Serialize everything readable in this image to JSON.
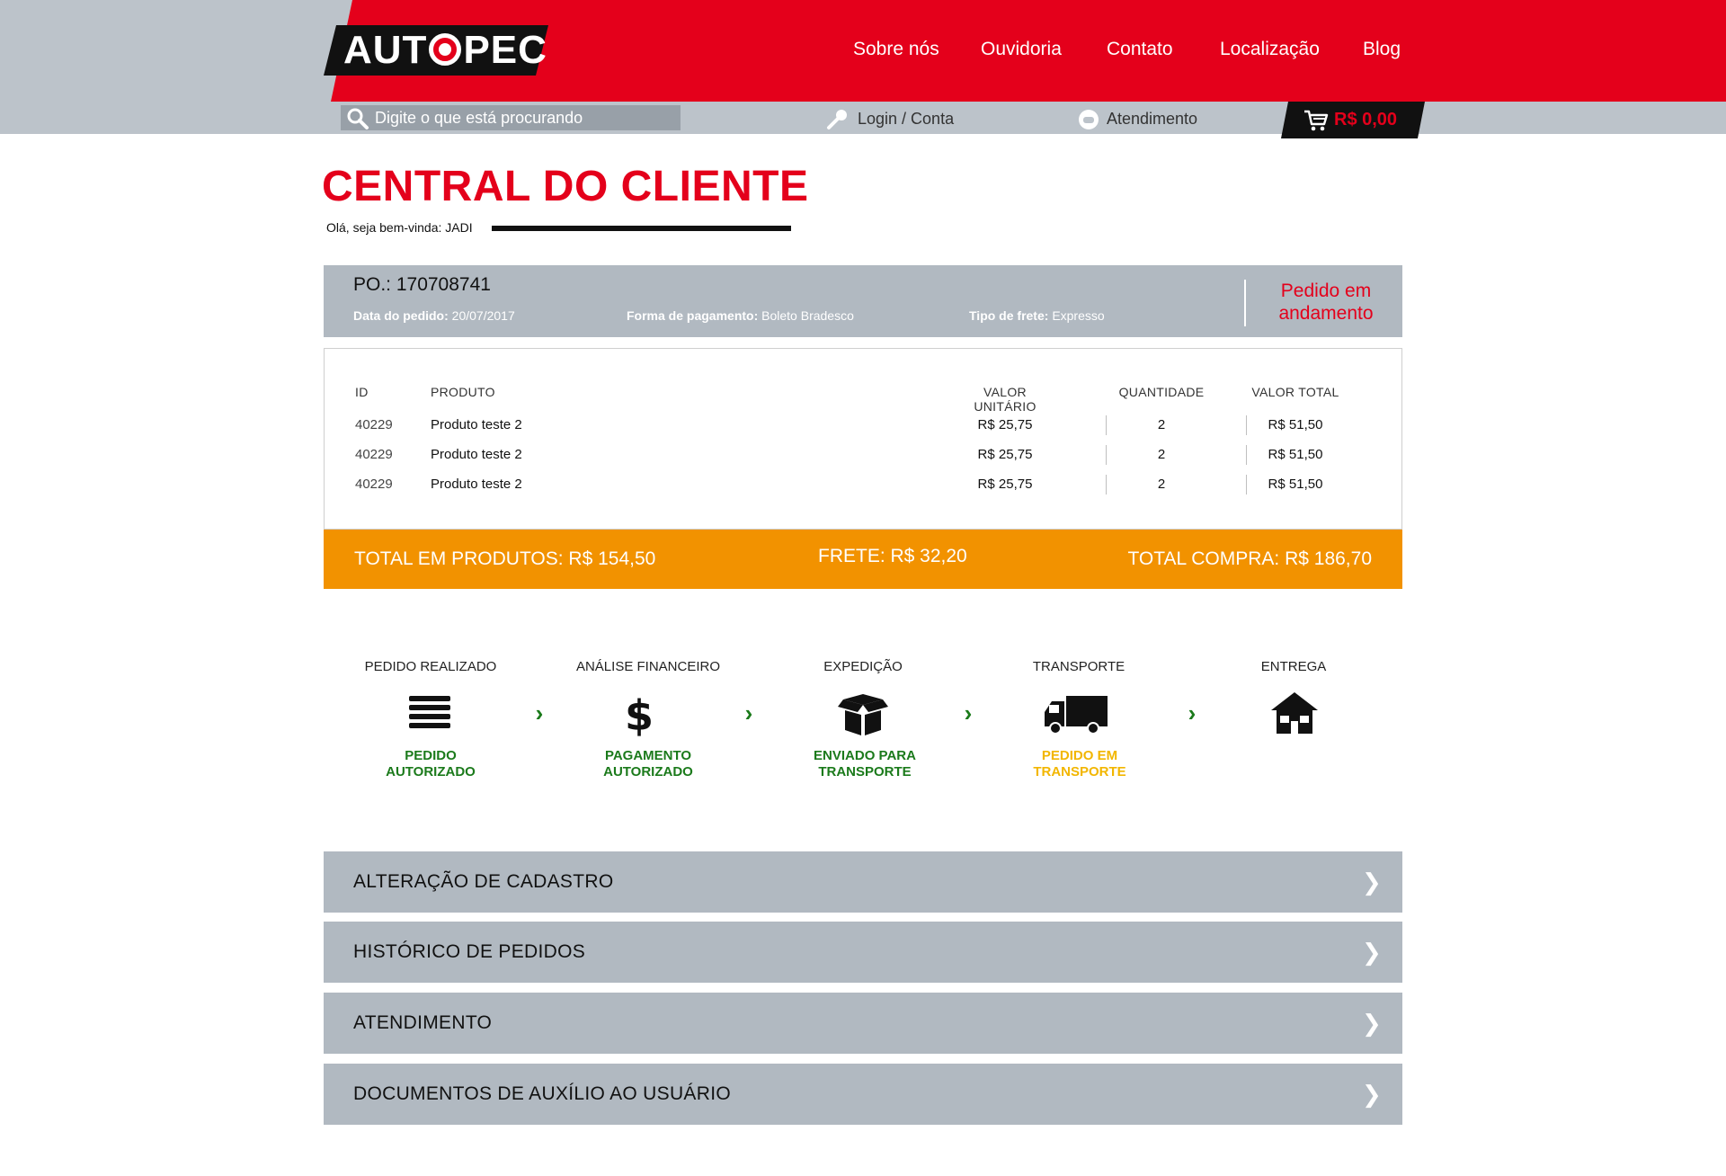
{
  "header": {
    "logo_text_1": "AUT",
    "logo_text_2": "PEC",
    "nav": [
      "Sobre nós",
      "Ouvidoria",
      "Contato",
      "Localização",
      "Blog"
    ],
    "search_placeholder": "Digite o que está procurando",
    "login_label": "Login / Conta",
    "support_label": "Atendimento",
    "cart_total": "R$ 0,00"
  },
  "page": {
    "title": "CENTRAL DO CLIENTE",
    "greeting": "Olá, seja bem-vinda: JADI"
  },
  "order": {
    "po": "PO.: 170708741",
    "date_label": "Data do pedido:",
    "date_value": "20/07/2017",
    "payment_label": "Forma de pagamento:",
    "payment_value": "Boleto Bradesco",
    "shipping_label": "Tipo de frete:",
    "shipping_value": "Expresso",
    "status_line1": "Pedido em",
    "status_line2": "andamento"
  },
  "items": {
    "headers": [
      "ID",
      "PRODUTO",
      "VALOR UNITÁRIO",
      "QUANTIDADE",
      "VALOR TOTAL"
    ],
    "rows": [
      {
        "id": "40229",
        "name": "Produto teste 2",
        "unit": "R$ 25,75",
        "qty": "2",
        "total": "R$ 51,50"
      },
      {
        "id": "40229",
        "name": "Produto teste 2",
        "unit": "R$ 25,75",
        "qty": "2",
        "total": "R$ 51,50"
      },
      {
        "id": "40229",
        "name": "Produto teste 2",
        "unit": "R$ 25,75",
        "qty": "2",
        "total": "R$ 51,50"
      }
    ]
  },
  "totals": {
    "products": "TOTAL EM PRODUTOS: R$ 154,50",
    "shipping": "FRETE: R$ 32,20",
    "purchase": "TOTAL COMPRA: R$ 186,70"
  },
  "tracking": {
    "steps": [
      {
        "label": "PEDIDO REALIZADO",
        "icon": "list-icon",
        "status_1": "PEDIDO",
        "status_2": "AUTORIZADO",
        "color": "#1b7a1b"
      },
      {
        "label": "ANÁLISE FINANCEIRO",
        "icon": "dollar-icon",
        "status_1": "PAGAMENTO",
        "status_2": "AUTORIZADO",
        "color": "#1b7a1b"
      },
      {
        "label": "EXPEDIÇÃO",
        "icon": "box-icon",
        "status_1": "ENVIADO PARA",
        "status_2": "TRANSPORTE",
        "color": "#1b7a1b"
      },
      {
        "label": "TRANSPORTE",
        "icon": "truck-icon",
        "status_1": "PEDIDO EM",
        "status_2": "TRANSPORTE",
        "color": "#f2b600"
      },
      {
        "label": "ENTREGA",
        "icon": "house-icon",
        "status_1": "",
        "status_2": "",
        "color": "#1b7a1b"
      }
    ],
    "arrow": "›"
  },
  "accordion": {
    "items": [
      "ALTERAÇÃO DE CADASTRO",
      "HISTÓRICO DE PEDIDOS",
      "ATENDIMENTO",
      "DOCUMENTOS DE AUXÍLIO AO USUÁRIO"
    ],
    "chevron": "❯"
  },
  "colors": {
    "brand_red": "#e4001b",
    "orange": "#f29200",
    "panel_grey": "#b1b9c1",
    "status_green": "#1b7a1b",
    "status_yellow": "#f2b600"
  }
}
